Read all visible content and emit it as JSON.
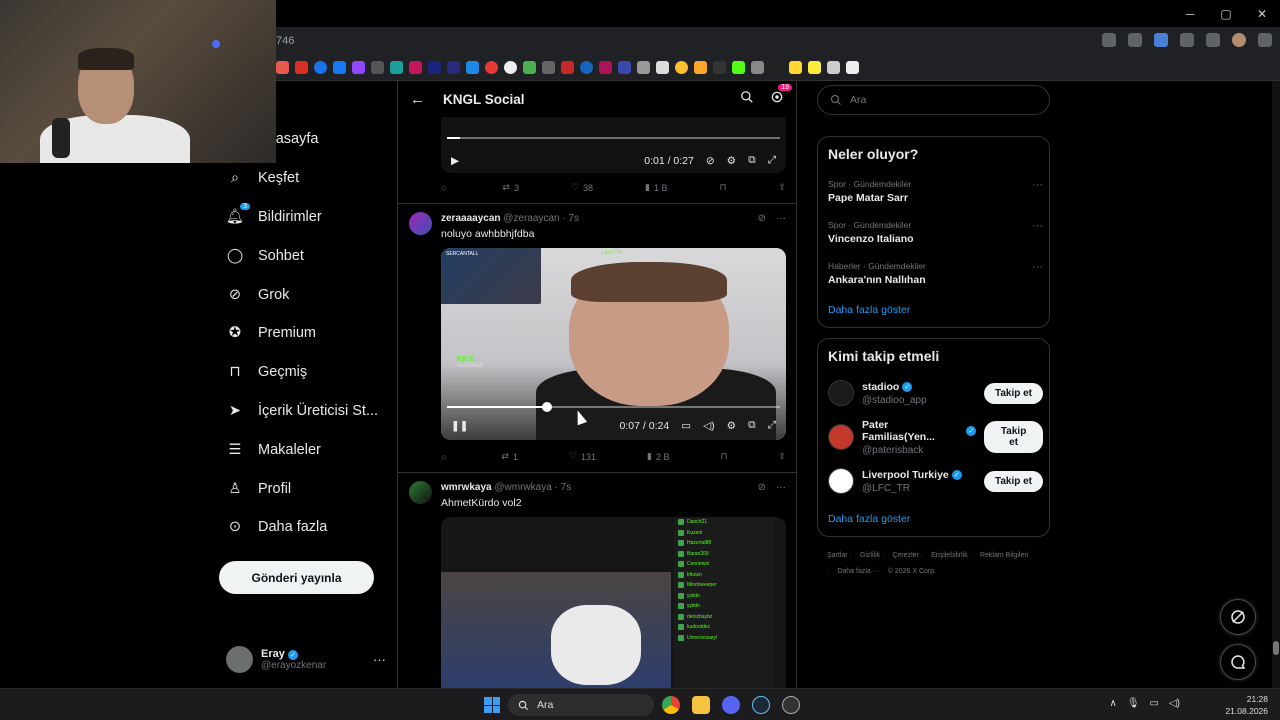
{
  "browser": {
    "url": "746",
    "win_controls": [
      "─",
      "▢",
      "✕"
    ]
  },
  "nav": {
    "items": [
      {
        "label": "Anasayfa",
        "icon": "home-icon"
      },
      {
        "label": "Keşfet",
        "icon": "search-icon"
      },
      {
        "label": "Bildirimler",
        "icon": "bell-icon",
        "badge": "3"
      },
      {
        "label": "Sohbet",
        "icon": "chat-icon"
      },
      {
        "label": "Grok",
        "icon": "grok-icon"
      },
      {
        "label": "Premium",
        "icon": "premium-icon"
      },
      {
        "label": "Geçmiş",
        "icon": "bookmark-icon"
      },
      {
        "label": "İçerik Üreticisi St...",
        "icon": "rocket-icon"
      },
      {
        "label": "Makaleler",
        "icon": "article-icon"
      },
      {
        "label": "Profil",
        "icon": "person-icon"
      },
      {
        "label": "Daha fazla",
        "icon": "more-circle-icon"
      }
    ],
    "post_button": "Gönderi yayınla",
    "account": {
      "name": "Eray",
      "handle": "@erayozkenar"
    }
  },
  "center": {
    "title": "KNGL Social",
    "settings_badge": "19",
    "video1": {
      "time": "0:01 / 0:27",
      "progress": 0.04
    },
    "post1_actions": {
      "replies": "",
      "reposts": "3",
      "likes": "38",
      "views": "1 B"
    },
    "post2": {
      "name": "zeraaaaycan",
      "handle": "@zeraaycan",
      "time": "7s",
      "text": "noluyo awhbbhjfdba",
      "video": {
        "time": "0:07 / 0:24",
        "progress": 0.3,
        "pip_label": "SERCANTALL",
        "kick_label": "KICK",
        "kick_sub": "sercantall",
        "top_label": "Last77K"
      },
      "actions": {
        "replies": "",
        "reposts": "1",
        "likes": "131",
        "views": "2 B"
      }
    },
    "post3": {
      "name": "wmrwkaya",
      "handle": "@wmrwkaya",
      "time": "7s",
      "text": "AhmetKürdo vol2",
      "chat": [
        "Danch21",
        "Kuzeni",
        "Hazertal88",
        "Baran209",
        "Connewni",
        "kfezan",
        "Mindsweeper",
        "yyiido",
        "yyiido",
        "denizbaybz",
        "kudoutdec",
        "Unnecessary!"
      ]
    }
  },
  "right": {
    "search_placeholder": "Ara",
    "trends_title": "Neler oluyor?",
    "trends": [
      {
        "category": "Spor · Gündemdekiler",
        "name": "Pape Matar Sarr"
      },
      {
        "category": "Spor · Gündemdekiler",
        "name": "Vincenzo Italiano"
      },
      {
        "category": "Haberler · Gündemdekiler",
        "name": "Ankara'nın Nallıhan"
      }
    ],
    "trends_more": "Daha fazla göster",
    "follow_title": "Kimi takip etmeli",
    "follow": [
      {
        "name": "stadioo",
        "handle": "@stadioo_app",
        "color": "#1a1a1a"
      },
      {
        "name": "Pater Familias(Yen...",
        "handle": "@paterisback",
        "color": "#c0392b"
      },
      {
        "name": "Liverpool Turkiye",
        "handle": "@LFC_TR",
        "color": "#ffffff"
      }
    ],
    "follow_button": "Takip et",
    "follow_more": "Daha fazla göster",
    "footer": [
      "Şartlar ·",
      "Gizlilik ·",
      "Çerezler ·",
      "Erişilebilirlik ·",
      "Reklam Bilgileri ·",
      "Daha fazla ···",
      "© 2026 X Corp."
    ]
  },
  "taskbar": {
    "search": "Ara",
    "time": "21:28",
    "date": "21.08.2026"
  },
  "colors": {
    "accent": "#1d9bf0",
    "bg": "#000000",
    "border": "#2f3336",
    "muted": "#71767b"
  }
}
